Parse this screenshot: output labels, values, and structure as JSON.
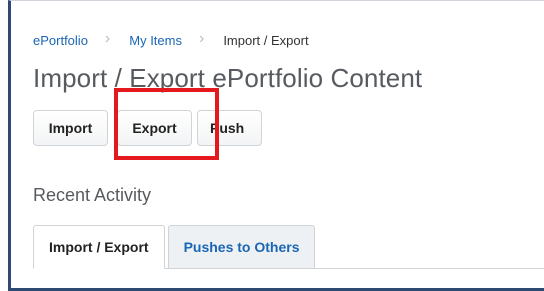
{
  "breadcrumb": {
    "items": [
      "ePortfolio",
      "My Items",
      "Import / Export"
    ],
    "separator": "›"
  },
  "page": {
    "title": "Import / Export ePortfolio Content"
  },
  "actions": {
    "import_label": "Import",
    "export_label": "Export",
    "push_label": "Push"
  },
  "recent_activity": {
    "title": "Recent Activity",
    "tabs": [
      {
        "label": "Import / Export",
        "active": true
      },
      {
        "label": "Pushes to Others",
        "active": false
      }
    ]
  },
  "colors": {
    "link": "#1a66b5",
    "highlight": "#e3191e",
    "frame": "#2c4a72"
  }
}
